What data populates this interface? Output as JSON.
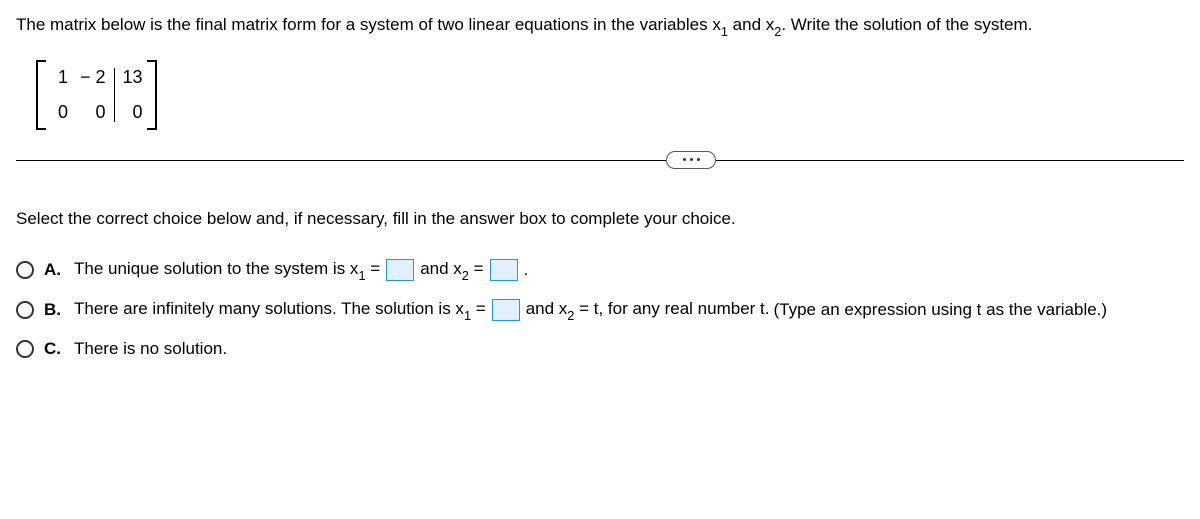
{
  "problem": {
    "text_before": "The matrix below is the final matrix form for a system of two linear equations in the variables x",
    "sub1": "1",
    "text_mid": " and x",
    "sub2": "2",
    "text_after": ". Write the solution of the system."
  },
  "matrix": {
    "r1c1": "1",
    "r1c2": "− 2",
    "r1aug": "13",
    "r2c1": "0",
    "r2c2": "0",
    "r2aug": "0"
  },
  "instruction": "Select the correct choice below and, if necessary, fill in the answer box to complete your choice.",
  "choices": {
    "a": {
      "letter": "A.",
      "text1": "The unique solution to the system is x",
      "sub1": "1",
      "eq": " = ",
      "text2": " and x",
      "sub2": "2",
      "eq2": " = ",
      "period": "."
    },
    "b": {
      "letter": "B.",
      "text1": "There are infinitely many solutions. The solution is x",
      "sub1": "1",
      "eq": " = ",
      "text2": " and x",
      "sub2": "2",
      "text3": " = t, for any real number t. ",
      "hint": "(Type an expression using t as the variable.)"
    },
    "c": {
      "letter": "C.",
      "text": "There is no solution."
    }
  }
}
